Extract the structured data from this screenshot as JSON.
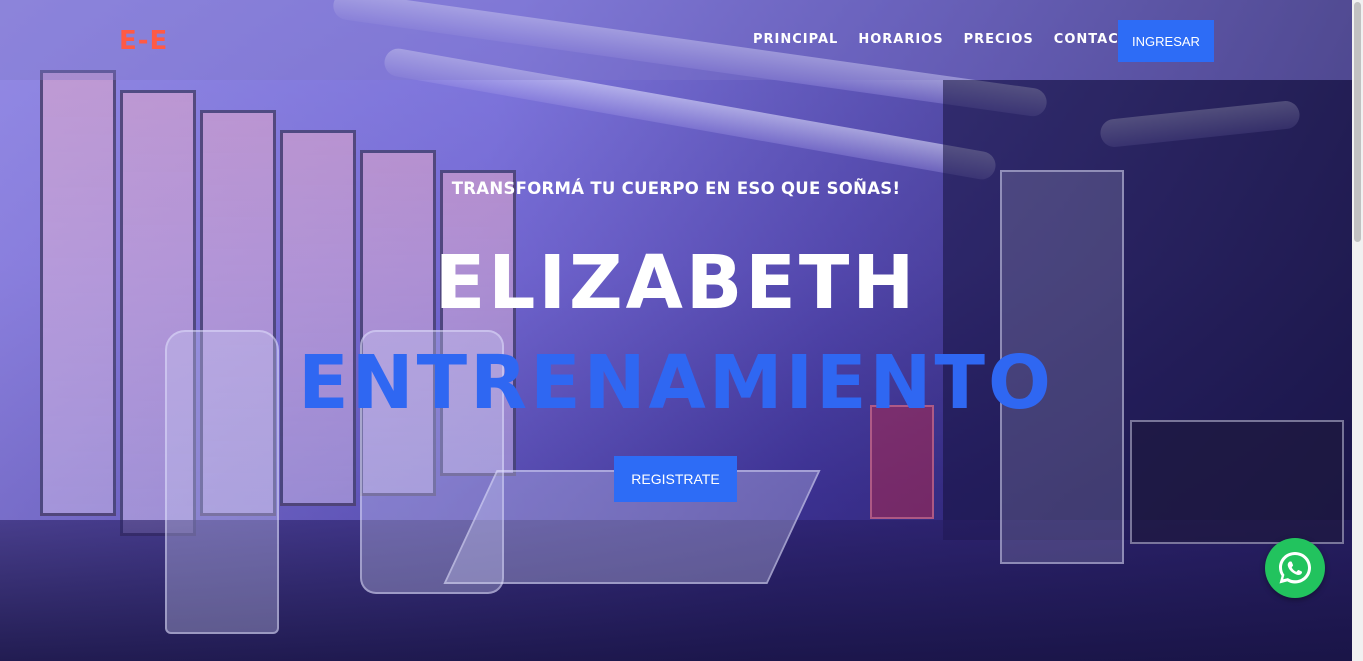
{
  "header": {
    "logo": "E-E",
    "nav": [
      {
        "label": "PRINCIPAL"
      },
      {
        "label": "HORARIOS"
      },
      {
        "label": "PRECIOS"
      },
      {
        "label": "CONTACTO"
      }
    ],
    "login_label": "INGRESAR"
  },
  "hero": {
    "tagline": "TRANSFORMÁ TU CUERPO EN ESO QUE SOÑAS!",
    "title_line1": "ELIZABETH",
    "title_line2": "ENTRENAMIENTO",
    "cta_label": "REGISTRATE",
    "background": "gym-interior-photo"
  },
  "floating": {
    "whatsapp_icon": "whatsapp-icon"
  },
  "colors": {
    "logo": "#ff5a45",
    "accent_blue": "#2d6cf6",
    "title_blue": "#2f67f2",
    "whatsapp_green": "#22c35e"
  }
}
